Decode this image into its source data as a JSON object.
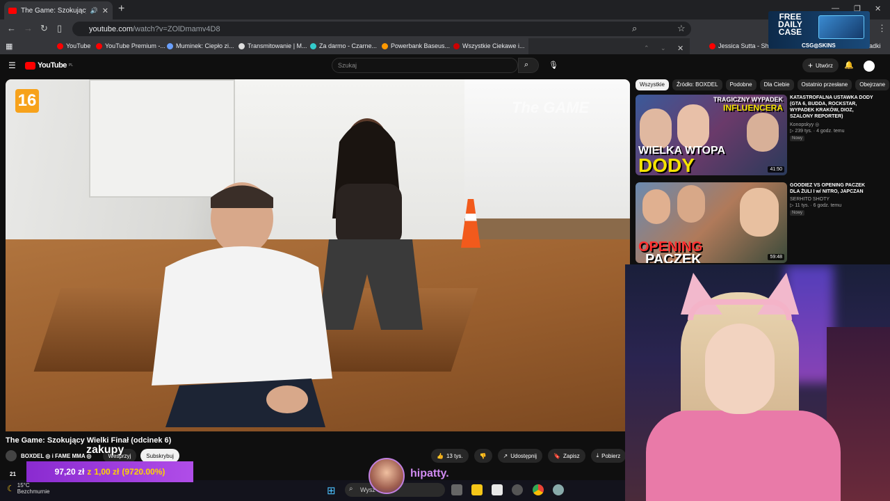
{
  "browser": {
    "tab_title": "The Game: Szokujący Wielki",
    "url_host": "youtube.com",
    "url_path": "/watch?v=ZOlDmamv4D8",
    "bookmarks": [
      "YouTube",
      "YouTube Premium -...",
      "Muminek: Ciepło zi...",
      "Transmitowanie | M...",
      "Za darmo - Czarne...",
      "Powerbank Baseus...",
      "Wszystkie Ciekawe i...",
      "Jessica Sutta - Show",
      "adki"
    ]
  },
  "youtube": {
    "logo": "YouTube",
    "logo_region": "PL",
    "search_placeholder": "Szukaj",
    "create_label": "Utwórz"
  },
  "player": {
    "age_rating": "16",
    "watermark": "The GAME"
  },
  "video": {
    "title": "The Game: Szokujący Wielki Finał (odcinek 6)",
    "channel": "BOXDEL ◎ i FAME MMA ◎",
    "support_label": "Wesprzyj",
    "subscribe_label": "Subskrybuj",
    "likes": "13 tys.",
    "share_label": "Udostępnij",
    "save_label": "Zapisz",
    "download_label": "Pobierz",
    "views_partial": "21"
  },
  "chips": [
    "Wszystkie",
    "Źródło: BOXDEL",
    "Podobne",
    "Dla Ciebie",
    "Ostatnio przesłane",
    "Obejrzane"
  ],
  "recommendations": [
    {
      "title": "KATASTROFALNA USTAWKA DODY (GTA 6, BUDDA, ROCKSTAR, WYPADEK KRAKÓW, DIOZ, SZALONY REPORTER)",
      "channel": "Konopskyy ◎",
      "stats": "▷ 239 tys. · 4 godz. temu",
      "badge": "Nowy",
      "duration": "41:50",
      "thumb_top": "TRAGICZNY WYPADEK",
      "thumb_sub": "INFLUENCERA",
      "thumb_big1": "WIELKA WTOPA",
      "thumb_big2": "DODY"
    },
    {
      "title": "GOODIEZ VS OPENING PACZEK DLA ŻULI I w/ NITRO, JAPCZAN",
      "channel": "SERHITO SHOTY",
      "stats": "▷ 11 tys. · 6 godz. temu",
      "badge": "Nowy",
      "duration": "59:48",
      "thumb_big1": "OPENING",
      "thumb_big2": "PACZEK"
    }
  ],
  "overlay": {
    "purchase_text": "zakupy",
    "donation_before": "97,20 zł",
    "donation_mid": "z",
    "donation_from": "1,00 zł",
    "donation_pct": "(9720.00%)",
    "username": "hipatty."
  },
  "ad": {
    "line1": "FREE",
    "line2": "DAILY",
    "line3": "CASE",
    "brand": "CSG◎SKINS"
  },
  "taskbar": {
    "temperature": "15°C",
    "weather": "Bezchmurnie",
    "search_text": "Wysz"
  }
}
